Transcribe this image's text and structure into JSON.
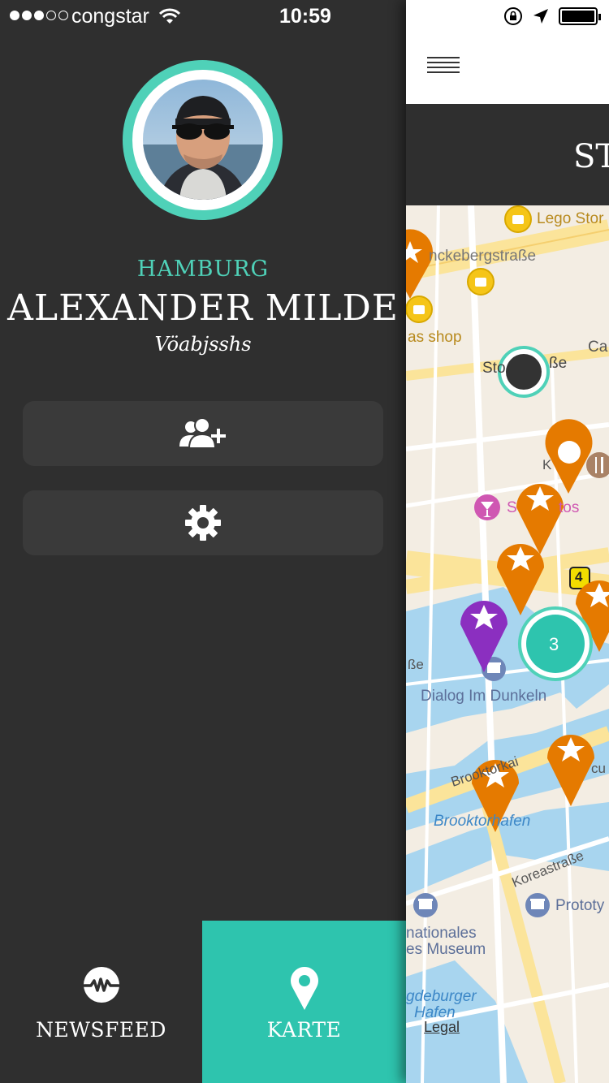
{
  "status_bar": {
    "carrier": "congstar",
    "time": "10:59"
  },
  "profile": {
    "city": "HAMBURG",
    "name": "ALEXANDER MILDE",
    "subtitle": "Vöabjsshs"
  },
  "menu": {
    "add_friend_icon": "add-friend-icon",
    "settings_icon": "gear-icon"
  },
  "tabs": [
    {
      "label": "NEWSFEED",
      "icon": "newsfeed-wave-icon",
      "active": false
    },
    {
      "label": "KARTE",
      "icon": "map-pin-icon",
      "active": true
    }
  ],
  "main": {
    "title": "ST",
    "map": {
      "labels": [
        "Lego Stor",
        "nckebergstraße",
        "as shop",
        "Ca",
        "Sto",
        "ße",
        "K",
        "S",
        "tos",
        "ße",
        "Dialog Im Dunkeln",
        "Brooktorkai",
        "Brooktorhafen",
        "cu",
        "Koreastraße",
        "Prototy",
        "nationales",
        "es Museum",
        "gdeburger",
        "Hafen",
        "4"
      ],
      "cluster_count": "3",
      "legal": "Legal"
    }
  },
  "colors": {
    "accent": "#2ec4ae",
    "ring": "#4fd1b8",
    "drawer_bg": "#2f2f2f",
    "pin_orange": "#e57a00",
    "pin_purple": "#8b2fc0",
    "water": "#a8d5ef",
    "road": "#fbe49a"
  }
}
